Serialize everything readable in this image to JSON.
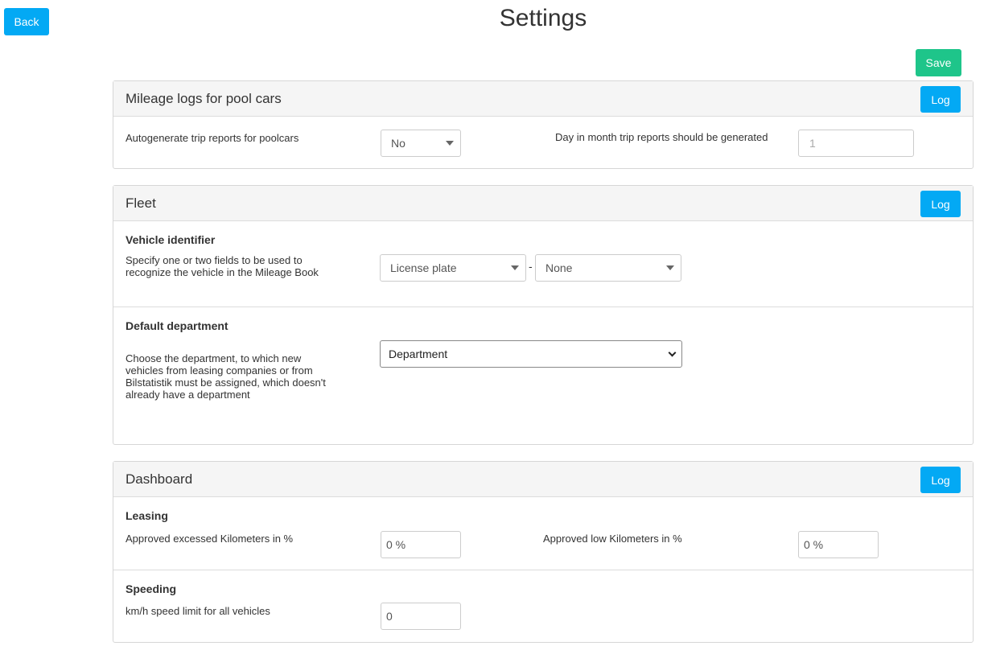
{
  "header": {
    "back_label": "Back",
    "title": "Settings",
    "save_label": "Save"
  },
  "mileage": {
    "title": "Mileage logs for pool cars",
    "log_label": "Log",
    "autogen_label": "Autogenerate trip reports for poolcars",
    "autogen_value": "No",
    "day_label": "Day in month trip reports should be generated",
    "day_value": "1"
  },
  "fleet": {
    "title": "Fleet",
    "log_label": "Log",
    "vehicle_identifier": {
      "heading": "Vehicle identifier",
      "description": "Specify one or two fields to be used to recognize the vehicle in the Mileage Book",
      "field1_value": "License plate",
      "separator": "-",
      "field2_value": "None"
    },
    "default_department": {
      "heading": "Default department",
      "description": "Choose the department, to which new vehicles from leasing companies or from Bilstatistik must be assigned, which doesn't already have a department",
      "value": "Department"
    }
  },
  "dashboard": {
    "title": "Dashboard",
    "log_label": "Log",
    "leasing": {
      "heading": "Leasing",
      "excess_label": "Approved excessed Kilometers in %",
      "excess_value": "0 %",
      "low_label": "Approved low Kilometers in %",
      "low_value": "0 %"
    },
    "speeding": {
      "heading": "Speeding",
      "limit_label": "km/h speed limit for all vehicles",
      "limit_value": "0"
    }
  },
  "colors": {
    "primary": "#03a9f4",
    "success": "#1ec58a"
  }
}
